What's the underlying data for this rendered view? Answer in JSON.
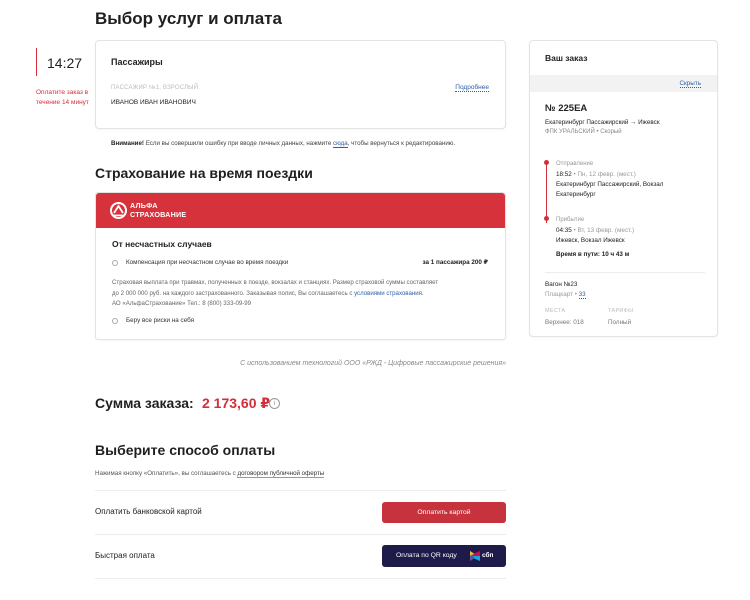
{
  "page": {
    "title": "Выбор услуг и оплата"
  },
  "timer": {
    "time": "14:27",
    "note": "Оплатите заказ в течение 14 минут"
  },
  "passengers": {
    "title": "Пассажиры",
    "label": "ПАССАЖИР №1, ВЗРОСЛЫЙ",
    "more": "Подробнее",
    "name": "ИВАНОВ ИВАН ИВАНОВИЧ"
  },
  "warning": {
    "bold": "Внимание!",
    "text": " Если вы совершили ошибку при вводе личных данных, нажмите ",
    "link": "сюда",
    "tail": ", чтобы вернуться к редактированию."
  },
  "insurance": {
    "title": "Страхование на время поездки",
    "brand_line1": "АЛЬФА",
    "brand_line2": "СТРАХОВАНИЕ",
    "accident_title": "От несчастных случаев",
    "option1": "Компенсация при несчастном случае во время поездки",
    "option1_price": "за 1 пассажира 200 ₽",
    "desc_line1": "Страховая выплата при травмах, полученных в поезде, вокзалах и станциях. Размер страховой суммы составляет",
    "desc_line2a": "до 2 000 000 руб. на каждого застрахованного. Заказывая полис, Вы соглашаетесь с ",
    "desc_link": "условиями страхования",
    "desc_line2b": ".",
    "desc_line3": "АО «АльфаСтрахование» Тел.: 8 (800) 333-09-99",
    "option2": "Беру все риски на себя"
  },
  "tech_note": "С использованием технологий ООО «РЖД - Цифровые пассажирские решения»",
  "sum": {
    "label": "Сумма заказа:",
    "value": "2 173,60 ₽",
    "info_icon": "i"
  },
  "payment": {
    "title": "Выберите способ оплаты",
    "note": "Нажимая кнопку «Оплатить», вы соглашаетесь с ",
    "note_link": "договором публичной оферты",
    "card_label": "Оплатить банковской картой",
    "card_button": "Оплатить картой",
    "fast_label": "Быстрая оплата",
    "qr_button": "Оплата по QR коду",
    "sbp": "сбп"
  },
  "order": {
    "title": "Ваш заказ",
    "hide": "Скрыть",
    "train": "№ 225ЕА",
    "route": "Екатеринбург Пассажирский → Ижевск",
    "carrier": "ФПК УРАЛЬСКИЙ • Скорый",
    "dep_label": "Отправление",
    "dep_time": "18:52",
    "dep_date": "• Пн, 12 февр. (мест.)",
    "dep_station1": "Екатеринбург Пассажирский, Вокзал",
    "dep_station2": "Екатеринбург",
    "arr_label": "Прибытие",
    "arr_time": "04:35",
    "arr_date": "• Вт, 13 февр. (мест.)",
    "arr_station": "Ижевск, Вокзал Ижевск",
    "travel": "Время в пути: 10 ч 43 м",
    "wagon": "Вагон №23",
    "place_label": "Плацкарт • ",
    "place_num": "33",
    "col1_label": "МЕСТА",
    "col1_value": "Верхнее: 018",
    "col2_label": "ТАРИФЫ",
    "col2_value": "Полный"
  },
  "colors": {
    "accent": "#d32f3a",
    "link": "#2b5fa8",
    "qr_button": "#1e1a4a",
    "alfa": "#d6323c"
  }
}
